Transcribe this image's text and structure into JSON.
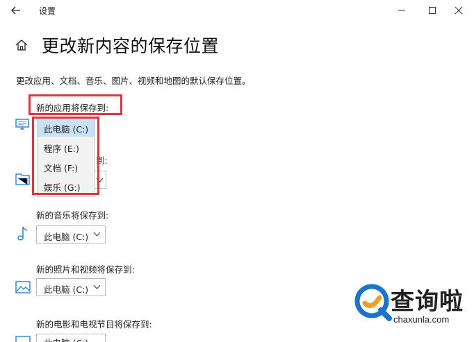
{
  "window": {
    "title": "设置"
  },
  "page": {
    "title": "更改新内容的保存位置",
    "description": "更改应用、文档、音乐、图片、视频和地图的默认保存位置。"
  },
  "apps": {
    "label": "新的应用将保存到:",
    "options": [
      "此电脑 (C:)",
      "程序 (E:)",
      "文档 (F:)",
      "娱乐 (G:)"
    ],
    "selected_index": 0
  },
  "documents": {
    "label_partial": "到:"
  },
  "music": {
    "label": "新的音乐将保存到:",
    "value": "此电脑 (C:)"
  },
  "photos": {
    "label": "新的照片和视频将保存到:",
    "value": "此电脑 (C:)"
  },
  "movies": {
    "label": "新的电影和电视节目将保存到:",
    "value": "此电脑 (C:)"
  },
  "watermark": {
    "brand": "查询啦",
    "url": "chaxunla.com"
  },
  "colors": {
    "highlight": "#d9363e",
    "selected": "#c9e1f5",
    "icon_blue": "#1b74c9"
  }
}
